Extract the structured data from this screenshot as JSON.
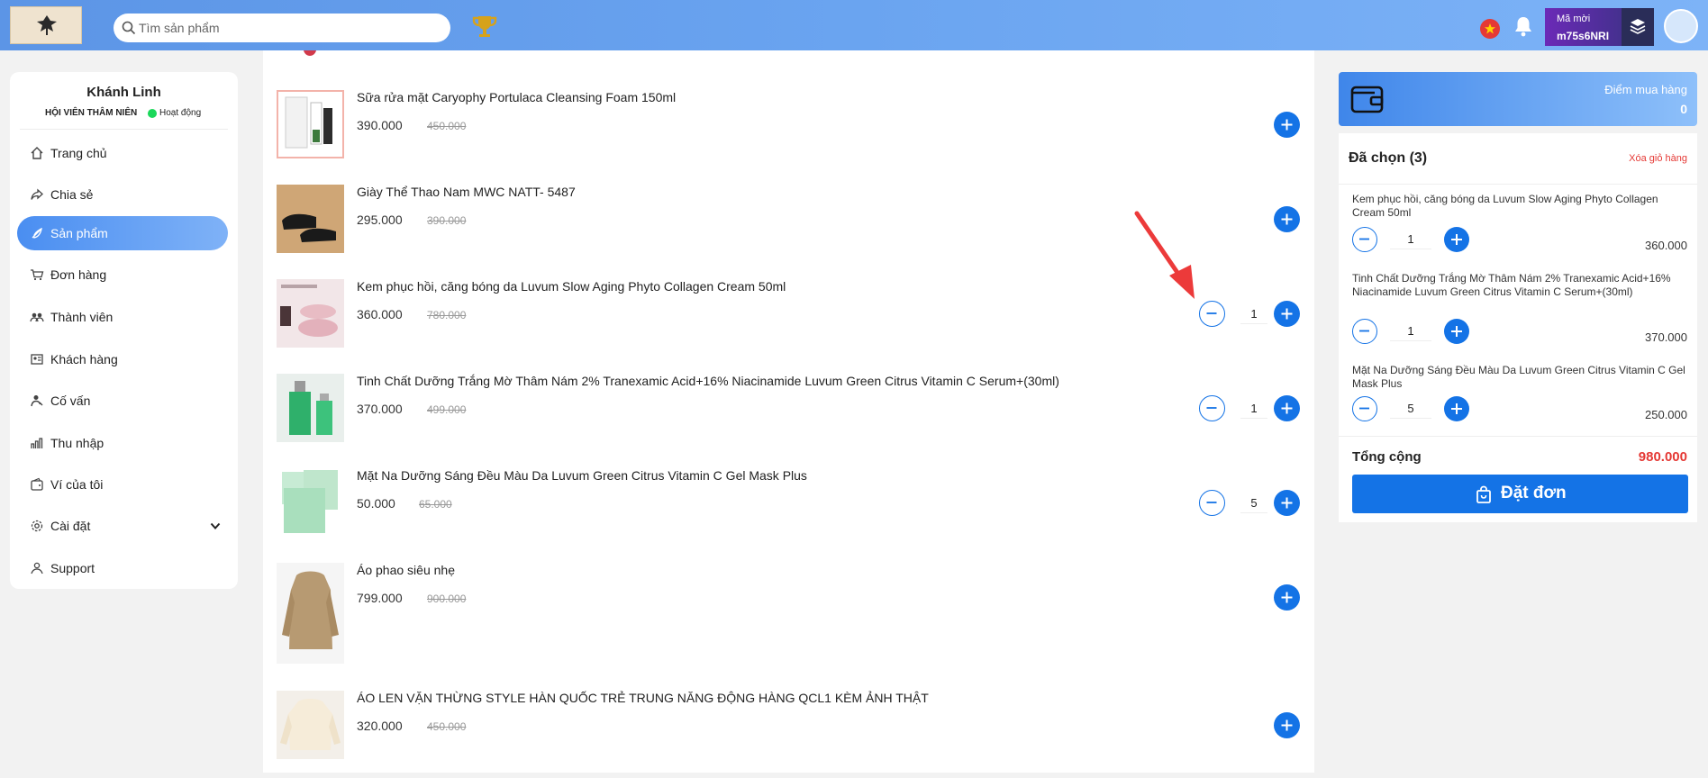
{
  "header": {
    "search_placeholder": "Tìm sản phẩm",
    "promo_label": "Mã mời",
    "promo_code": "m75s6NRI"
  },
  "sidebar": {
    "user_name": "Khánh Linh",
    "member_level": "HỘI VIÊN THÂM NIÊN",
    "status": "Hoạt động",
    "items": [
      {
        "label": "Trang chủ",
        "icon": "home-icon"
      },
      {
        "label": "Chia sẻ",
        "icon": "share-icon"
      },
      {
        "label": "Sản phẩm",
        "icon": "product-icon",
        "active": true
      },
      {
        "label": "Đơn hàng",
        "icon": "cart-icon"
      },
      {
        "label": "Thành viên",
        "icon": "members-icon"
      },
      {
        "label": "Khách hàng",
        "icon": "customers-icon"
      },
      {
        "label": "Cố vấn",
        "icon": "advisor-icon"
      },
      {
        "label": "Thu nhập",
        "icon": "income-icon"
      },
      {
        "label": "Ví của tôi",
        "icon": "wallet-icon"
      },
      {
        "label": "Cài đặt",
        "icon": "settings-icon"
      },
      {
        "label": "Support",
        "icon": "support-icon"
      }
    ]
  },
  "products": [
    {
      "name": "Sữa rửa mặt Caryophy Portulaca Cleansing Foam 150ml",
      "price": "390.000",
      "old_price": "450.000"
    },
    {
      "name": "Giày Thể Thao Nam MWC NATT- 5487",
      "price": "295.000",
      "old_price": "390.000"
    },
    {
      "name": "Kem phục hồi, căng bóng da Luvum Slow Aging Phyto Collagen Cream 50ml",
      "price": "360.000",
      "old_price": "780.000",
      "qty": "1"
    },
    {
      "name": "Tinh Chất Dưỡng Trắng Mờ Thâm Nám 2% Tranexamic Acid+16% Niacinamide Luvum Green Citrus Vitamin C Serum+(30ml)",
      "price": "370.000",
      "old_price": "499.000",
      "qty": "1"
    },
    {
      "name": "Mặt Na Dưỡng Sáng Đều Màu Da Luvum Green Citrus Vitamin C Gel Mask Plus",
      "price": "50.000",
      "old_price": "65.000",
      "qty": "5"
    },
    {
      "name": "Áo phao siêu nhẹ",
      "price": "799.000",
      "old_price": "900.000"
    },
    {
      "name": "ÁO LEN VẶN THỪNG STYLE HÀN QUỐC TRẺ TRUNG NĂNG ĐỘNG HÀNG QCL1 KÈM ẢNH THẬT",
      "price": "320.000",
      "old_price": "450.000"
    }
  ],
  "points": {
    "label": "Điểm mua hàng",
    "value": "0"
  },
  "cart": {
    "title": "Đã chọn (3)",
    "clear_label": "Xóa giỏ hàng",
    "items": [
      {
        "name": "Kem phục hồi, căng bóng da Luvum Slow Aging Phyto Collagen Cream 50ml",
        "qty": "1",
        "price": "360.000"
      },
      {
        "name": "Tinh Chất Dưỡng Trắng Mờ Thâm Nám 2% Tranexamic Acid+16% Niacinamide Luvum Green Citrus Vitamin C Serum+(30ml)",
        "qty": "1",
        "price": "370.000"
      },
      {
        "name": "Mặt Na Dưỡng Sáng Đều Màu Da Luvum Green Citrus Vitamin C Gel Mask Plus",
        "qty": "5",
        "price": "250.000"
      }
    ],
    "total_label": "Tổng cộng",
    "total_value": "980.000",
    "order_label": "Đặt đơn"
  },
  "colors": {
    "accent": "#1473e6",
    "danger": "#e53935",
    "header_gradient_start": "#5c95e6",
    "header_gradient_end": "#7db3f7",
    "status_online": "#1bd85a"
  }
}
